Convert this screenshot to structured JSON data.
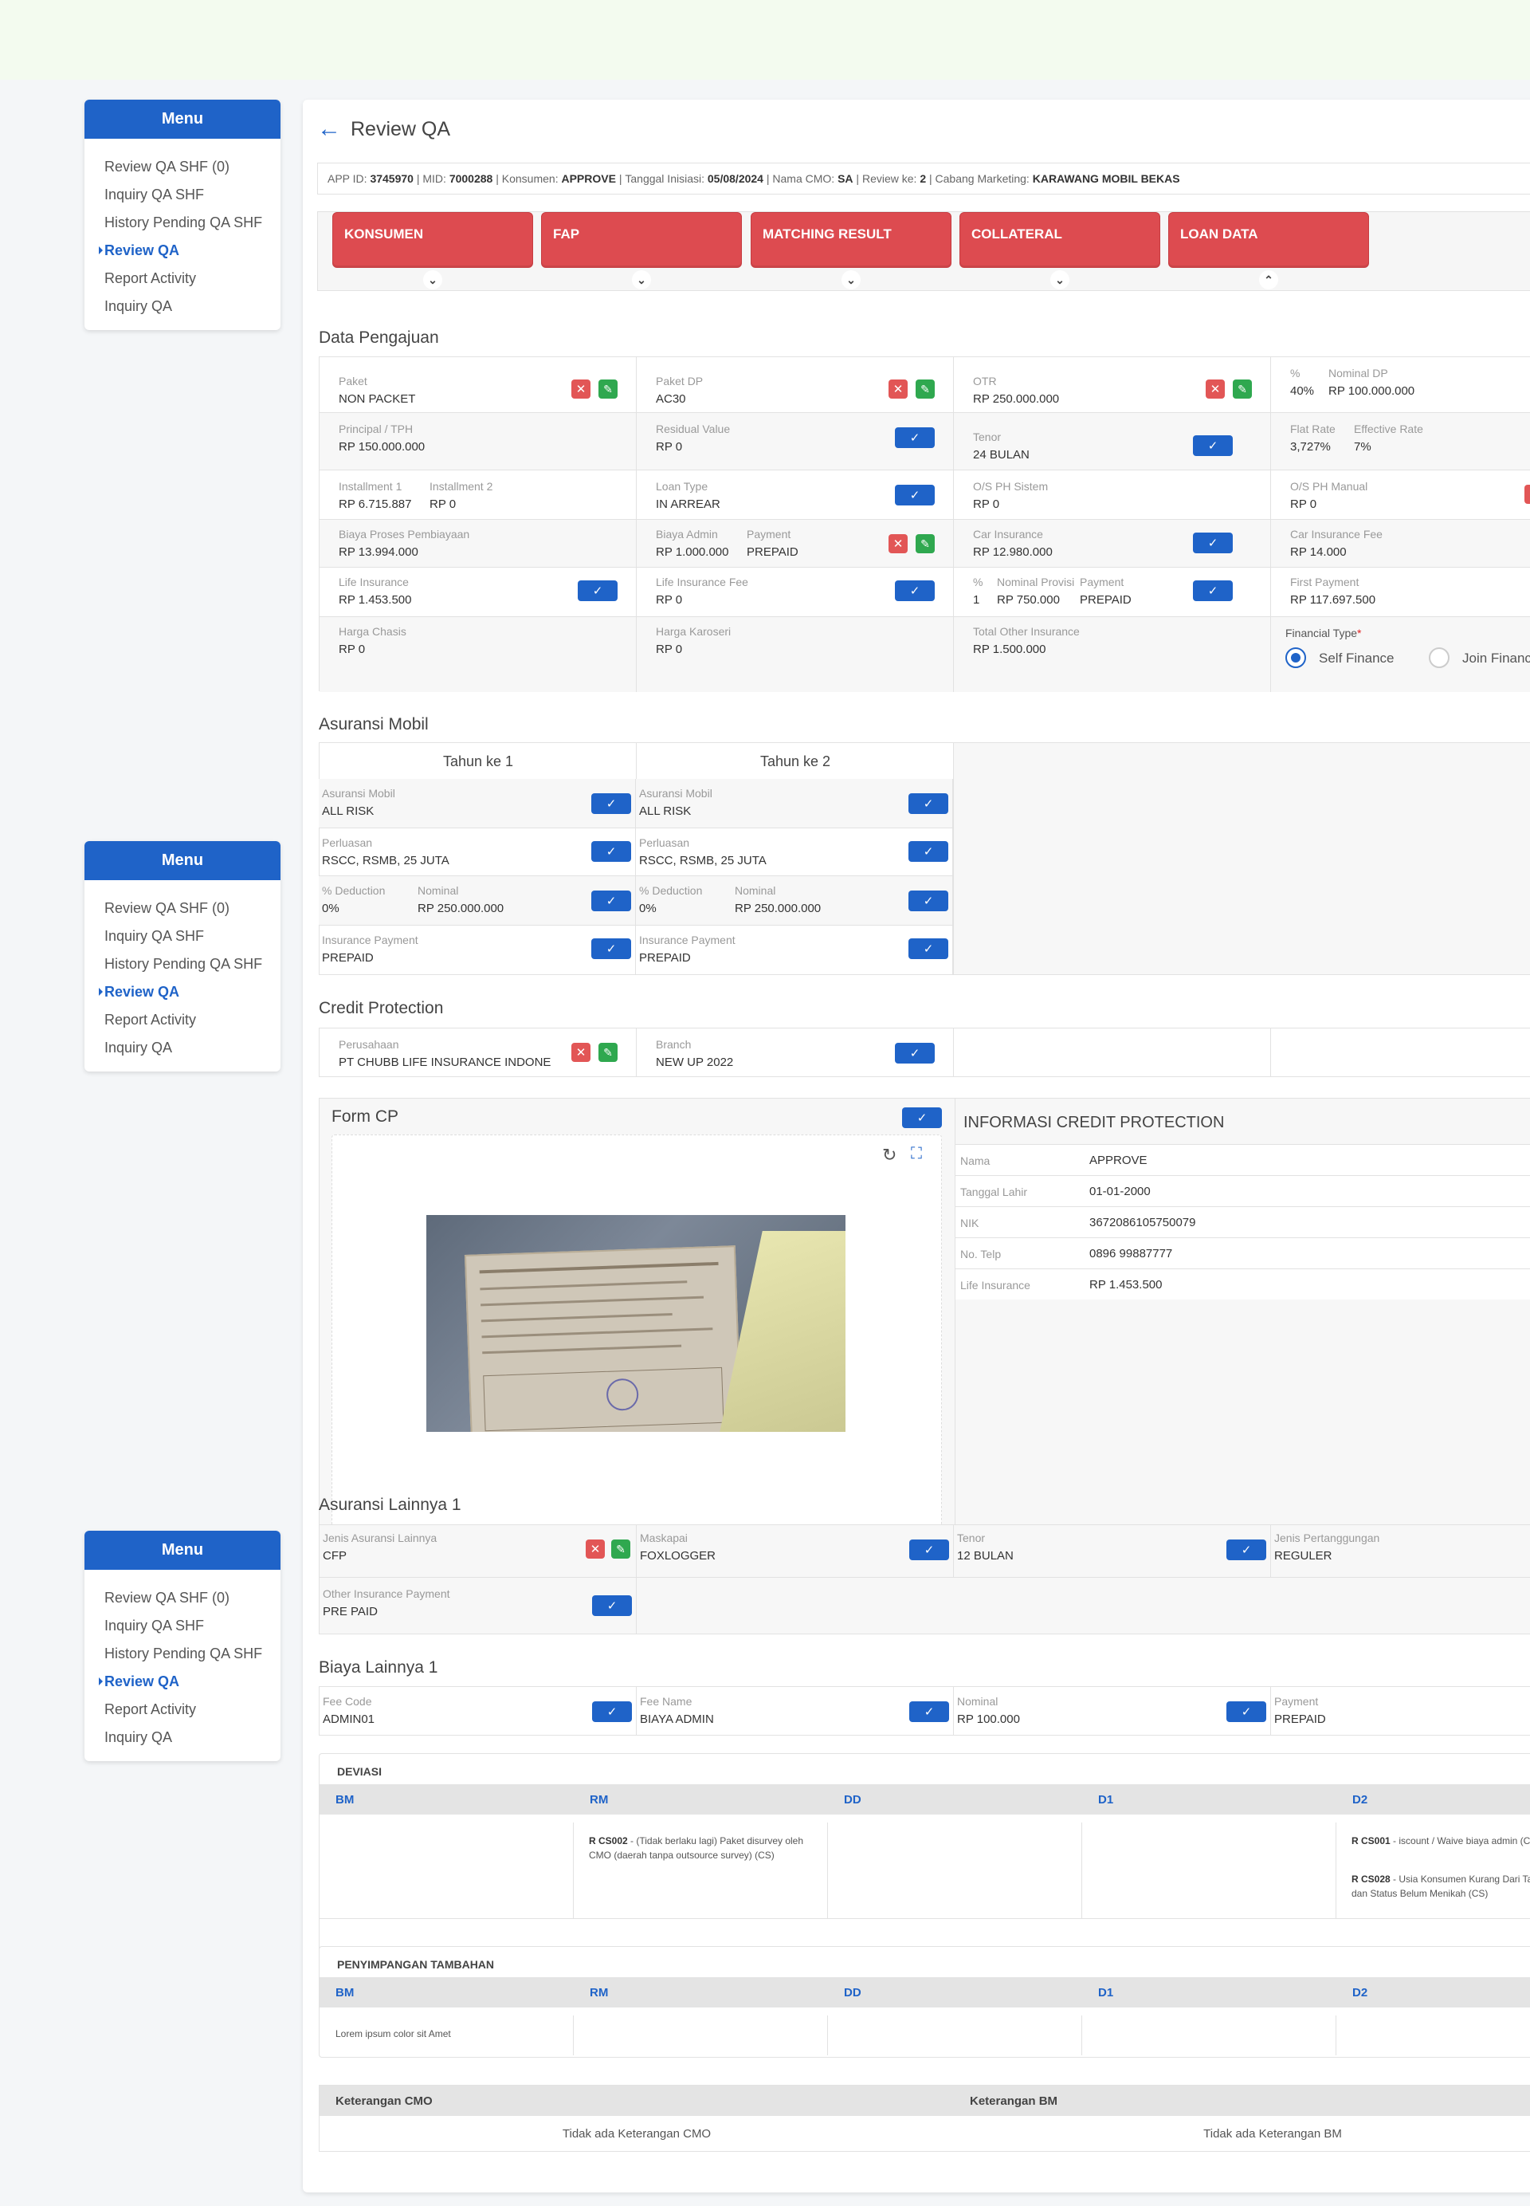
{
  "menu": {
    "title": "Menu",
    "items": [
      "Review QA SHF (0)",
      "Inquiry QA SHF",
      "History Pending QA SHF",
      "Review QA",
      "Report Activity",
      "Inquiry QA"
    ],
    "active_index": 3
  },
  "page": {
    "title": "Review QA"
  },
  "info": {
    "app_id_label": "APP ID:",
    "app_id": "3745970",
    "mid_label": "MID:",
    "mid": "7000288",
    "konsumen_label": "Konsumen:",
    "konsumen": "APPROVE",
    "tgl_label": "Tanggal Inisiasi:",
    "tgl": "05/08/2024",
    "cmo_label": "Nama CMO:",
    "cmo": "SA",
    "review_label": "Review ke:",
    "review": "2",
    "cabang_label": "Cabang Marketing:",
    "cabang": "KARAWANG MOBIL BEKAS",
    "sep": "|"
  },
  "tabs": [
    "KONSUMEN",
    "FAP",
    "MATCHING RESULT",
    "COLLATERAL",
    "LOAN DATA"
  ],
  "data_pengajuan": {
    "title": "Data Pengajuan",
    "paket_l": "Paket",
    "paket_v": "NON PACKET",
    "paketdp_l": "Paket DP",
    "paketdp_v": "AC30",
    "otr_l": "OTR",
    "otr_v": "RP 250.000.000",
    "dp_pct_l": "%",
    "dp_pct_v": "40%",
    "dp_nom_l": "Nominal DP",
    "dp_nom_v": "RP 100.000.000",
    "principal_l": "Principal / TPH",
    "principal_v": "RP 150.000.000",
    "residual_l": "Residual Value",
    "residual_v": "RP 0",
    "tenor_l": "Tenor",
    "tenor_v": "24 BULAN",
    "flat_l": "Flat Rate",
    "flat_v": "3,727%",
    "eff_l": "Effective Rate",
    "eff_v": "7%",
    "inst1_l": "Installment 1",
    "inst1_v": "RP 6.715.887",
    "inst2_l": "Installment 2",
    "inst2_v": "RP 0",
    "loantype_l": "Loan Type",
    "loantype_v": "IN ARREAR",
    "osph_l": "O/S PH Sistem",
    "osph_v": "RP 0",
    "osphm_l": "O/S PH Manual",
    "osphm_v": "RP 0",
    "biayaproses_l": "Biaya Proses Pembiayaan",
    "biayaproses_v": "RP 13.994.000",
    "biayaadmin_l": "Biaya Admin",
    "biayaadmin_v": "RP 1.000.000",
    "payment_l": "Payment",
    "payment_v": "PREPAID",
    "carins_l": "Car Insurance",
    "carins_v": "RP 12.980.000",
    "carfee_l": "Car Insurance Fee",
    "carfee_v": "RP 14.000",
    "lifeins_l": "Life Insurance",
    "lifeins_v": "RP 1.453.500",
    "lifefee_l": "Life Insurance Fee",
    "lifefee_v": "RP 0",
    "prov_pct_l": "%",
    "prov_pct_v": "1",
    "prov_nom_l": "Nominal Provisi",
    "prov_nom_v": "RP 750.000",
    "prov_pay_l": "Payment",
    "prov_pay_v": "PREPAID",
    "firstpay_l": "First Payment",
    "firstpay_v": "RP 117.697.500",
    "chasis_l": "Harga Chasis",
    "chasis_v": "RP 0",
    "karoseri_l": "Harga Karoseri",
    "karoseri_v": "RP 0",
    "totalother_l": "Total Other Insurance",
    "totalother_v": "RP 1.500.000",
    "fintype_l": "Financial Type",
    "fintype_req": "*",
    "self": "Self Finance",
    "join": "Join Finance"
  },
  "asuransi": {
    "title": "Asuransi Mobil",
    "years": [
      "Tahun ke 1",
      "Tahun ke 2"
    ],
    "asm_l": "Asuransi Mobil",
    "asm_v": "ALL RISK",
    "perl_l": "Perluasan",
    "perl_v": "RSCC, RSMB, 25 JUTA",
    "ded_l": "% Deduction",
    "ded_v": "0%",
    "nom_l": "Nominal",
    "nom_v": "RP 250.000.000",
    "pay_l": "Insurance Payment",
    "pay_v": "PREPAID"
  },
  "credit": {
    "title": "Credit Protection",
    "per_l": "Perusahaan",
    "per_v": "PT CHUBB LIFE INSURANCE INDONE",
    "branch_l": "Branch",
    "branch_v": "NEW UP 2022",
    "form_title": "Form CP",
    "info_title": "INFORMASI CREDIT PROTECTION",
    "rows": [
      {
        "l": "Nama",
        "v": "APPROVE"
      },
      {
        "l": "Tanggal Lahir",
        "v": "01-01-2000"
      },
      {
        "l": "NIK",
        "v": "3672086105750079"
      },
      {
        "l": "No. Telp",
        "v": "0896 99887777"
      },
      {
        "l": "Life Insurance",
        "v": "RP 1.453.500"
      }
    ]
  },
  "lainnya": {
    "title": "Asuransi Lainnya 1",
    "jenis_l": "Jenis Asuransi Lainnya",
    "jenis_v": "CFP",
    "mask_l": "Maskapai",
    "mask_v": "FOXLOGGER",
    "tenor_l": "Tenor",
    "tenor_v": "12 BULAN",
    "tang_l": "Jenis Pertanggungan",
    "tang_v": "REGULER",
    "pay_l": "Other Insurance Payment",
    "pay_v": "PRE PAID"
  },
  "biaya": {
    "title": "Biaya Lainnya 1",
    "code_l": "Fee Code",
    "code_v": "ADMIN01",
    "name_l": "Fee Name",
    "name_v": "BIAYA ADMIN",
    "nom_l": "Nominal",
    "nom_v": "RP 100.000",
    "pay_l": "Payment",
    "pay_v": "PREPAID"
  },
  "deviasi": {
    "title": "DEVIASI",
    "cols": [
      "BM",
      "RM",
      "DD",
      "D1",
      "D2"
    ],
    "rm_code": "R CS002",
    "rm_text": " - (Tidak berlaku lagi) Paket disurvey oleh CMO (daerah tanpa outsource survey) (CS)",
    "d2a_code": "R CS001",
    "d2a_text": " - iscount / Waive biaya admin (CS)",
    "d2b_code": "R CS028",
    "d2b_text": " - Usia Konsumen Kurang Dari Tahun dan Status Belum Menikah (CS)"
  },
  "penyimpangan": {
    "title": "PENYIMPANGAN TAMBAHAN",
    "cols": [
      "BM",
      "RM",
      "DD",
      "D1",
      "D2"
    ],
    "bm_text": "Lorem ipsum color sit Amet"
  },
  "keterangan": {
    "cmo_l": "Keterangan CMO",
    "bm_l": "Keterangan BM",
    "cmo_v": "Tidak ada Keterangan CMO",
    "bm_v": "Tidak ada Keterangan BM"
  }
}
